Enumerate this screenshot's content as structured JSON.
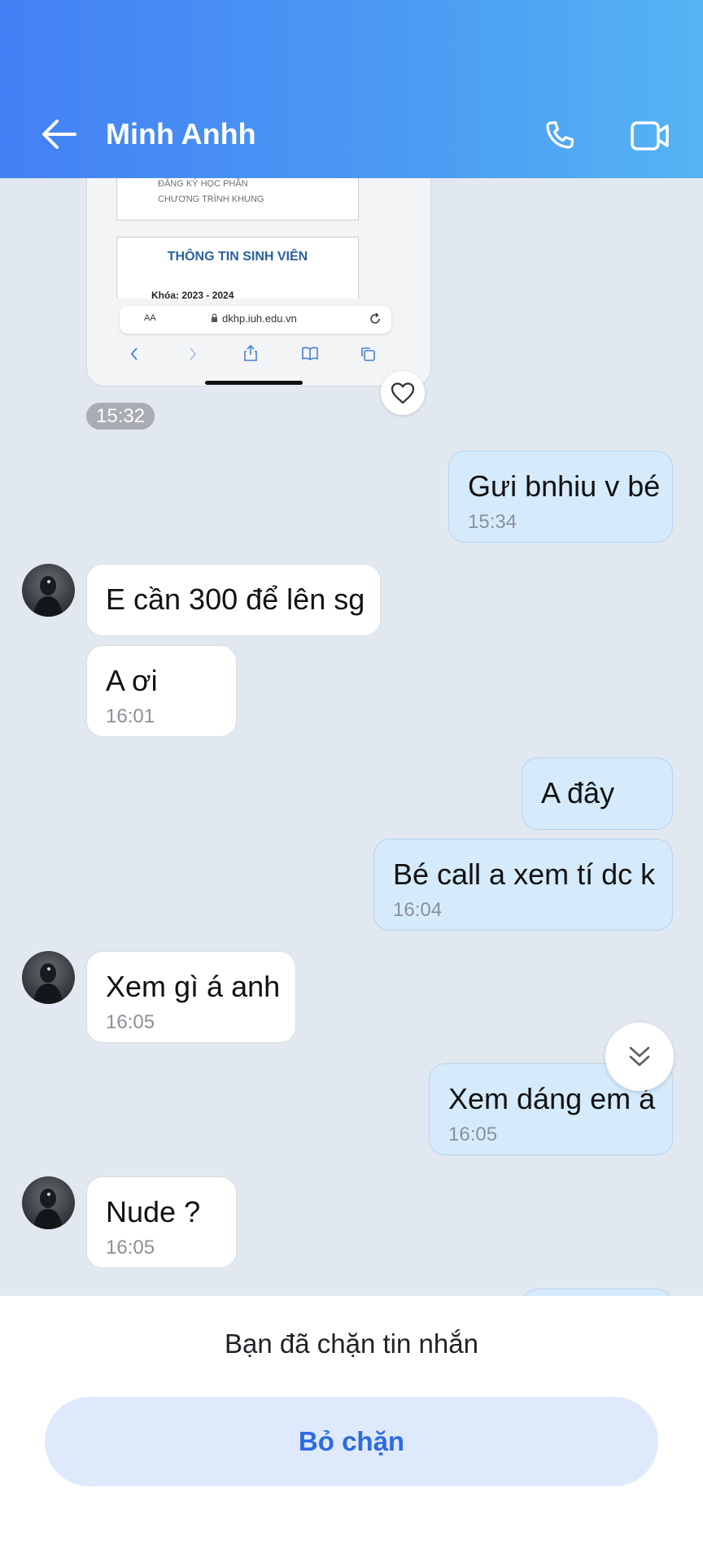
{
  "header": {
    "contact_name": "Minh Anhh",
    "back_icon": "arrow-left-icon",
    "call_icon": "phone-icon",
    "video_icon": "video-camera-icon",
    "gradient_start": "#4380f5",
    "gradient_end": "#55b4f3"
  },
  "image_message": {
    "doc_line1": "ĐĂNG KÝ HỌC PHẦN",
    "doc_line2": "CHƯƠNG TRÌNH KHUNG",
    "doc_heading": "THÔNG TIN SINH VIÊN",
    "doc_partial": "Khóa: 2023 - 2024",
    "url_aa": "AA",
    "url": "dkhp.iuh.edu.vn",
    "time": "15:32"
  },
  "messages": [
    {
      "dir": "out",
      "text": "Gưi bnhiu v bé",
      "time": "15:34"
    },
    {
      "dir": "in",
      "text": "E cần 300 để lên sg",
      "time": ""
    },
    {
      "dir": "in",
      "text": "A ơi",
      "time": "16:01"
    },
    {
      "dir": "out",
      "text": "A đây",
      "time": ""
    },
    {
      "dir": "out",
      "text": "Bé call a xem tí dc k",
      "time": "16:04"
    },
    {
      "dir": "in",
      "text": "Xem gì á anh",
      "time": "16:05"
    },
    {
      "dir": "out",
      "text": "Xem dáng em á",
      "time": "16:05"
    },
    {
      "dir": "in",
      "text": "Nude ?",
      "time": "16:05"
    }
  ],
  "footer": {
    "blocked_text": "Bạn đã chặn tin nhắn",
    "unblock_label": "Bỏ chặn"
  },
  "colors": {
    "chat_bg": "#e2e8f0",
    "outgoing_bubble": "#d5ebfc",
    "incoming_bubble": "#ffffff",
    "accent": "#2f6ae0"
  }
}
